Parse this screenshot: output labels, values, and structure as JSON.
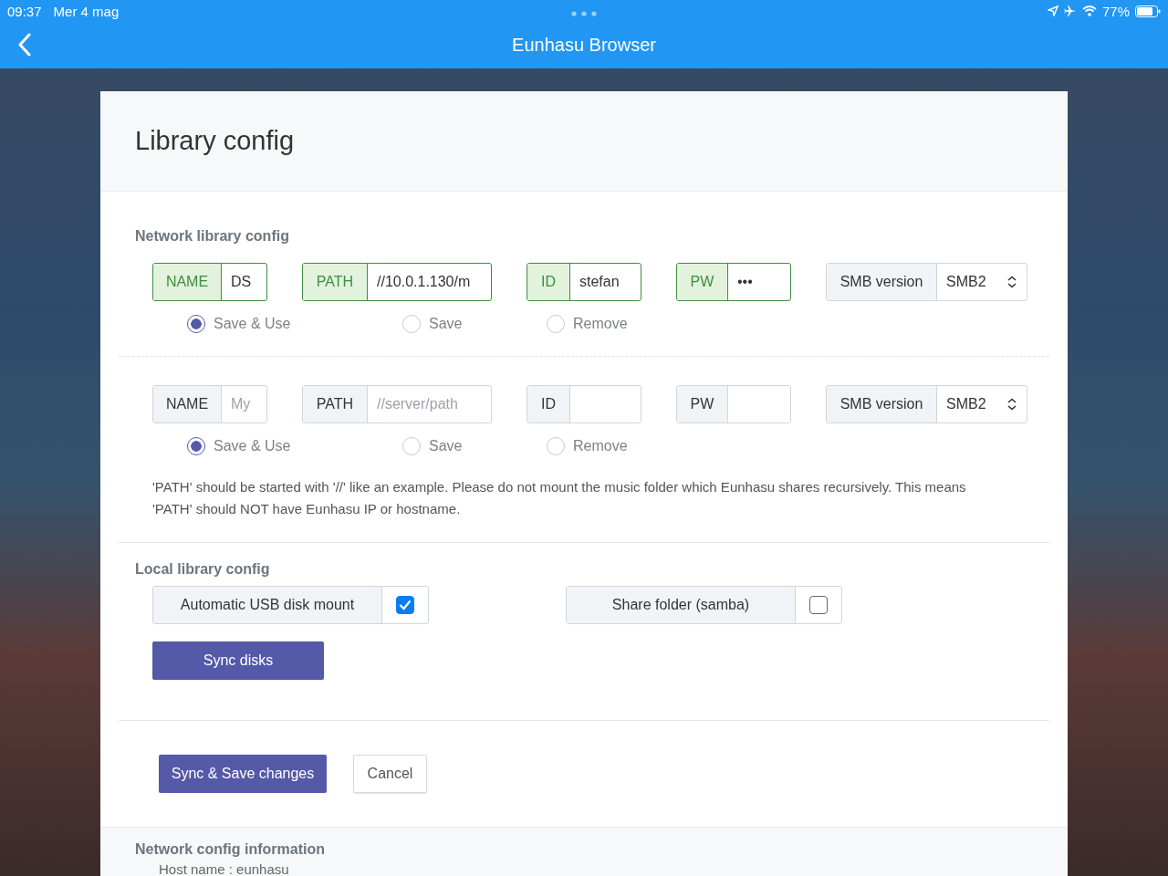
{
  "status_bar": {
    "time": "09:37",
    "date": "Mer 4 mag",
    "battery": "77%"
  },
  "nav": {
    "title": "Eunhasu Browser"
  },
  "card": {
    "title": "Library config"
  },
  "network": {
    "heading": "Network library config",
    "libraries": [
      {
        "valid": true,
        "fields": [
          {
            "kind": "text",
            "label": "NAME",
            "value": "DS"
          },
          {
            "kind": "text",
            "label": "PATH",
            "value": "//10.0.1.130/m"
          },
          {
            "kind": "text",
            "label": "ID",
            "value": "stefan"
          },
          {
            "kind": "text",
            "label": "PW",
            "value": "•••"
          },
          {
            "kind": "select",
            "label": "SMB version",
            "value": "SMB2"
          }
        ],
        "options": [
          {
            "label": "Save & Use",
            "selected": true
          },
          {
            "label": "Save",
            "selected": false
          },
          {
            "label": "Remove",
            "selected": false
          }
        ]
      },
      {
        "valid": false,
        "fields": [
          {
            "kind": "text",
            "label": "NAME",
            "placeholder": "My"
          },
          {
            "kind": "text",
            "label": "PATH",
            "placeholder": "//server/path"
          },
          {
            "kind": "text",
            "label": "ID"
          },
          {
            "kind": "text",
            "label": "PW"
          },
          {
            "kind": "select",
            "label": "SMB version",
            "value": "SMB2"
          }
        ],
        "options": [
          {
            "label": "Save & Use",
            "selected": true
          },
          {
            "label": "Save",
            "selected": false
          },
          {
            "label": "Remove",
            "selected": false
          }
        ]
      }
    ],
    "note": "'PATH' should be started with '//' like an example. Please do not mount the music folder which Eunhasu shares recursively. This means 'PATH' should NOT have Eunhasu IP or hostname."
  },
  "local": {
    "heading": "Local library config",
    "toggles": [
      {
        "label": "Automatic USB disk mount",
        "checked": true
      },
      {
        "label": "Share folder (samba)",
        "checked": false
      }
    ],
    "button": "Sync disks"
  },
  "actions": {
    "primary": "Sync & Save changes",
    "secondary": "Cancel"
  },
  "info": {
    "heading": "Network config information",
    "lines": [
      "Host name : eunhasu"
    ]
  }
}
